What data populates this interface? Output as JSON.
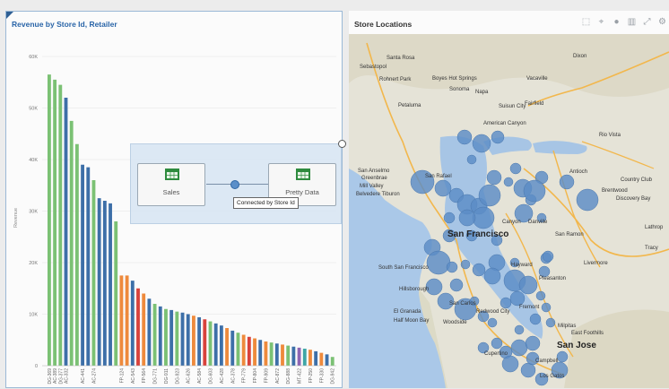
{
  "left_panel": {
    "title": "Revenue by Store Id, Retailer"
  },
  "overlay": {
    "source_label": "Sales",
    "target_label": "Pretty Data",
    "tooltip": "Connected by Store Id"
  },
  "right_panel": {
    "title": "Store Locations",
    "toolbar_icons": [
      "lasso-icon",
      "select-icon",
      "pin-icon",
      "chart-icon",
      "expand-icon",
      "gear-icon"
    ]
  },
  "map_labels": [
    {
      "text": "Santa Rosa",
      "key": "santa_rosa"
    },
    {
      "text": "Sebastopol",
      "key": "sebastopol"
    },
    {
      "text": "Rohnert Park",
      "key": "rohnert"
    },
    {
      "text": "Boyes Hot Springs",
      "key": "boyes"
    },
    {
      "text": "Sonoma",
      "key": "sonoma"
    },
    {
      "text": "Napa",
      "key": "napa"
    },
    {
      "text": "Petaluma",
      "key": "petaluma"
    },
    {
      "text": "Suisun City",
      "key": "suisun"
    },
    {
      "text": "Fairfield",
      "key": "fairfield"
    },
    {
      "text": "Vacaville",
      "key": "vacaville"
    },
    {
      "text": "Dixon",
      "key": "dixon"
    },
    {
      "text": "American Canyon",
      "key": "american_canyon"
    },
    {
      "text": "Rio Vista",
      "key": "rio_vista"
    },
    {
      "text": "San Anselmo",
      "key": "san_anselmo"
    },
    {
      "text": "Greenbrae",
      "key": "greenbrae"
    },
    {
      "text": "Mill Valley",
      "key": "mill_valley"
    },
    {
      "text": "Belvedere Tiburon",
      "key": "belvedere"
    },
    {
      "text": "San Rafael",
      "key": "san_rafael"
    },
    {
      "text": "Antioch",
      "key": "antioch"
    },
    {
      "text": "Country Club",
      "key": "country_club"
    },
    {
      "text": "Brentwood",
      "key": "brentwood"
    },
    {
      "text": "Discovery Bay",
      "key": "discovery_bay"
    },
    {
      "text": "Canyon",
      "key": "canyon"
    },
    {
      "text": "Danville",
      "key": "danville"
    },
    {
      "text": "San Francisco",
      "key": "san_francisco"
    },
    {
      "text": "San Ramon",
      "key": "san_ramon"
    },
    {
      "text": "Lathrop",
      "key": "lathrop"
    },
    {
      "text": "South San Francisco",
      "key": "ssf"
    },
    {
      "text": "Hayward",
      "key": "hayward"
    },
    {
      "text": "Livermore",
      "key": "livermore"
    },
    {
      "text": "Pleasanton",
      "key": "pleasanton"
    },
    {
      "text": "Hillsborough",
      "key": "hillsborough"
    },
    {
      "text": "Fremont",
      "key": "fremont"
    },
    {
      "text": "El Granada",
      "key": "el_granada"
    },
    {
      "text": "Half Moon Bay",
      "key": "half_moon_bay"
    },
    {
      "text": "San Carlos",
      "key": "san_carlos"
    },
    {
      "text": "Redwood City",
      "key": "redwood"
    },
    {
      "text": "Woodside",
      "key": "woodside"
    },
    {
      "text": "Milpitas",
      "key": "milpitas"
    },
    {
      "text": "East Foothills",
      "key": "east_foothills"
    },
    {
      "text": "San Jose",
      "key": "san_jose"
    },
    {
      "text": "Cupertino",
      "key": "cupertino"
    },
    {
      "text": "Campbell",
      "key": "campbell"
    },
    {
      "text": "Los Gatos",
      "key": "los_gatos"
    },
    {
      "text": "Tracy",
      "key": "tracy"
    }
  ],
  "chart_data": {
    "type": "bar",
    "title": "Revenue by Store Id, Retailer",
    "ylabel": "Revenue",
    "ylim": [
      0,
      60000
    ],
    "yticks": [
      "0",
      "10K",
      "20K",
      "30K",
      "40K",
      "50K",
      "60K"
    ],
    "colors": {
      "green": "#7bc174",
      "blue": "#3d6fa8",
      "orange": "#ee8a3c",
      "red": "#d8423c",
      "purple": "#8e65b3",
      "teal": "#3fa6a6"
    },
    "bars": [
      {
        "cat": "DG-369",
        "value": 56500,
        "color": "green"
      },
      {
        "cat": "AC-389",
        "value": 55500,
        "color": "green"
      },
      {
        "cat": "DG-377",
        "value": 54500,
        "color": "green"
      },
      {
        "cat": "AC-332",
        "value": 52000,
        "color": "blue"
      },
      {
        "cat": "",
        "value": 47500,
        "color": "green"
      },
      {
        "cat": "",
        "value": 43000,
        "color": "green"
      },
      {
        "cat": "AC-441",
        "value": 39000,
        "color": "blue"
      },
      {
        "cat": "",
        "value": 38500,
        "color": "blue"
      },
      {
        "cat": "AC-274",
        "value": 36000,
        "color": "green"
      },
      {
        "cat": "",
        "value": 32500,
        "color": "blue"
      },
      {
        "cat": "",
        "value": 32000,
        "color": "blue"
      },
      {
        "cat": "",
        "value": 31500,
        "color": "blue"
      },
      {
        "cat": "",
        "value": 28000,
        "color": "green"
      },
      {
        "cat": "FP-124",
        "value": 17500,
        "color": "orange"
      },
      {
        "cat": "",
        "value": 17500,
        "color": "orange"
      },
      {
        "cat": "AC-543",
        "value": 16500,
        "color": "blue"
      },
      {
        "cat": "",
        "value": 15000,
        "color": "red"
      },
      {
        "cat": "FP-564",
        "value": 14000,
        "color": "orange"
      },
      {
        "cat": "",
        "value": 13000,
        "color": "blue"
      },
      {
        "cat": "DG-771",
        "value": 12000,
        "color": "green"
      },
      {
        "cat": "",
        "value": 11500,
        "color": "blue"
      },
      {
        "cat": "DG-911",
        "value": 11000,
        "color": "green"
      },
      {
        "cat": "",
        "value": 10800,
        "color": "blue"
      },
      {
        "cat": "DG-923",
        "value": 10500,
        "color": "green"
      },
      {
        "cat": "",
        "value": 10300,
        "color": "blue"
      },
      {
        "cat": "AC-626",
        "value": 10000,
        "color": "blue"
      },
      {
        "cat": "",
        "value": 9700,
        "color": "orange"
      },
      {
        "cat": "AC-584",
        "value": 9400,
        "color": "blue"
      },
      {
        "cat": "",
        "value": 9000,
        "color": "red"
      },
      {
        "cat": "DG-603",
        "value": 8600,
        "color": "green"
      },
      {
        "cat": "",
        "value": 8200,
        "color": "blue"
      },
      {
        "cat": "AC-428",
        "value": 7800,
        "color": "blue"
      },
      {
        "cat": "",
        "value": 7300,
        "color": "orange"
      },
      {
        "cat": "AC-378",
        "value": 6800,
        "color": "blue"
      },
      {
        "cat": "",
        "value": 6400,
        "color": "green"
      },
      {
        "cat": "FP-779",
        "value": 6000,
        "color": "orange"
      },
      {
        "cat": "",
        "value": 5600,
        "color": "red"
      },
      {
        "cat": "FP-804",
        "value": 5300,
        "color": "orange"
      },
      {
        "cat": "",
        "value": 5000,
        "color": "blue"
      },
      {
        "cat": "FP-909",
        "value": 4700,
        "color": "orange"
      },
      {
        "cat": "",
        "value": 4500,
        "color": "green"
      },
      {
        "cat": "AC-872",
        "value": 4300,
        "color": "blue"
      },
      {
        "cat": "",
        "value": 4100,
        "color": "orange"
      },
      {
        "cat": "DG-888",
        "value": 3900,
        "color": "green"
      },
      {
        "cat": "",
        "value": 3700,
        "color": "blue"
      },
      {
        "cat": "MT-422",
        "value": 3500,
        "color": "purple"
      },
      {
        "cat": "",
        "value": 3300,
        "color": "teal"
      },
      {
        "cat": "FP-250",
        "value": 3100,
        "color": "orange"
      },
      {
        "cat": "",
        "value": 2800,
        "color": "blue"
      },
      {
        "cat": "FP-330",
        "value": 2500,
        "color": "orange"
      },
      {
        "cat": "",
        "value": 2200,
        "color": "blue"
      },
      {
        "cat": "DG-942",
        "value": 1700,
        "color": "green"
      }
    ]
  }
}
